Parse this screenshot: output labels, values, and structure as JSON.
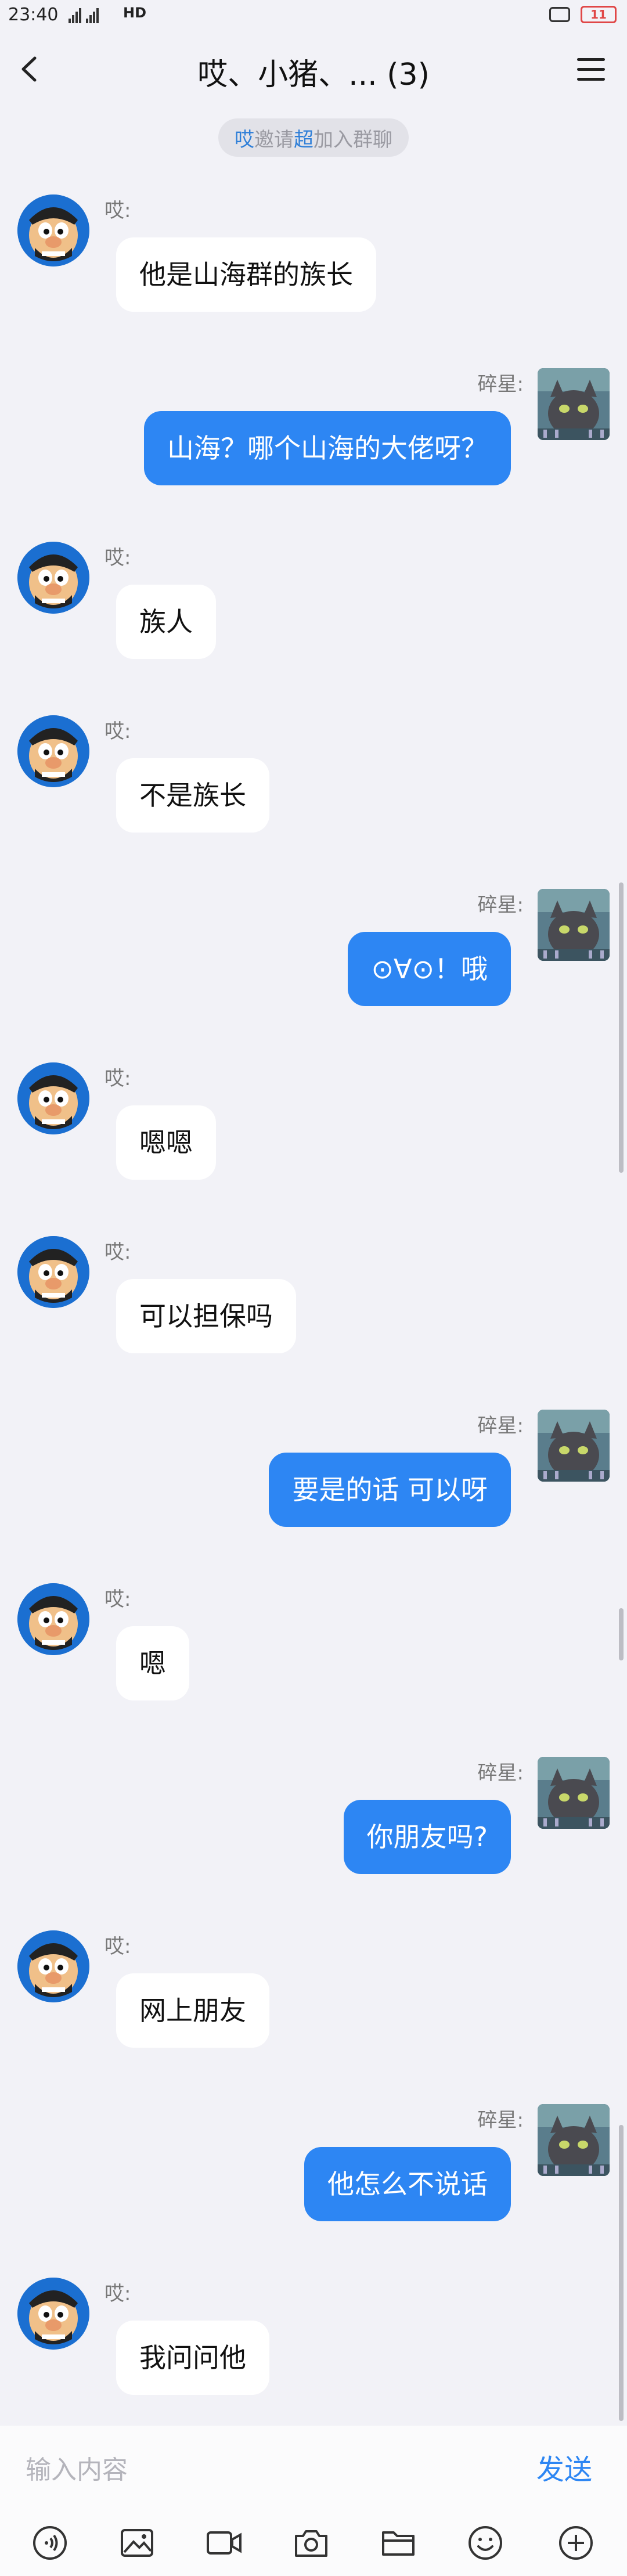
{
  "status_bar": {
    "time": "23:40",
    "network": "HD",
    "battery": "11"
  },
  "header": {
    "title": "哎、小猪、... (3)"
  },
  "notice": {
    "inviter": "哎",
    "invite_word": "邀请",
    "invitee": "超",
    "joined_text": "加入群聊"
  },
  "messages": [
    {
      "side": "left",
      "sender": "哎:",
      "text": "他是山海群的族长"
    },
    {
      "side": "right",
      "sender": "碎星:",
      "text": "山海？哪个山海的大佬呀？"
    },
    {
      "side": "left",
      "sender": "哎:",
      "text": "族人"
    },
    {
      "side": "left",
      "sender": "哎:",
      "text": "不是族长"
    },
    {
      "side": "right",
      "sender": "碎星:",
      "text": "⊙∀⊙！哦"
    },
    {
      "side": "left",
      "sender": "哎:",
      "text": "嗯嗯"
    },
    {
      "side": "left",
      "sender": "哎:",
      "text": "可以担保吗"
    },
    {
      "side": "right",
      "sender": "碎星:",
      "text": "要是的话 可以呀"
    },
    {
      "side": "left",
      "sender": "哎:",
      "text": "嗯"
    },
    {
      "side": "right",
      "sender": "碎星:",
      "text": "你朋友吗?"
    },
    {
      "side": "left",
      "sender": "哎:",
      "text": "网上朋友"
    },
    {
      "side": "right",
      "sender": "碎星:",
      "text": "他怎么不说话"
    },
    {
      "side": "left",
      "sender": "哎:",
      "text": "我问问他"
    }
  ],
  "input": {
    "placeholder": "输入内容",
    "send_label": "发送"
  },
  "toolbar": {
    "icons": [
      "voice-icon",
      "image-icon",
      "video-icon",
      "camera-icon",
      "folder-icon",
      "emoji-icon",
      "plus-icon"
    ]
  },
  "colors": {
    "accent": "#2d86f3",
    "background": "#f2f2f7"
  }
}
